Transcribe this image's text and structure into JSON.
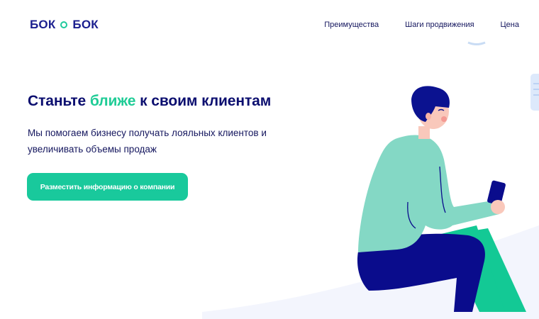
{
  "header": {
    "logo": {
      "left": "БОК",
      "right": "БОК"
    },
    "nav": [
      {
        "label": "Преимущества"
      },
      {
        "label": "Шаги продвижения"
      },
      {
        "label": "Цена"
      }
    ]
  },
  "hero": {
    "title_before": "Станьте ",
    "title_accent": "ближе",
    "title_after": " к своим клиентам",
    "subtitle": "Мы помогаем бизнесу получать лояльных клиентов и увеличивать объемы продаж",
    "cta_label": "Разместить информацию о компании"
  },
  "colors": {
    "brand_navy": "#0b0e6f",
    "brand_green": "#1fcc96",
    "button": "#19c99c",
    "shirt": "#84d8c5",
    "pants": "#0a0c8c",
    "hair": "#0b1290"
  }
}
